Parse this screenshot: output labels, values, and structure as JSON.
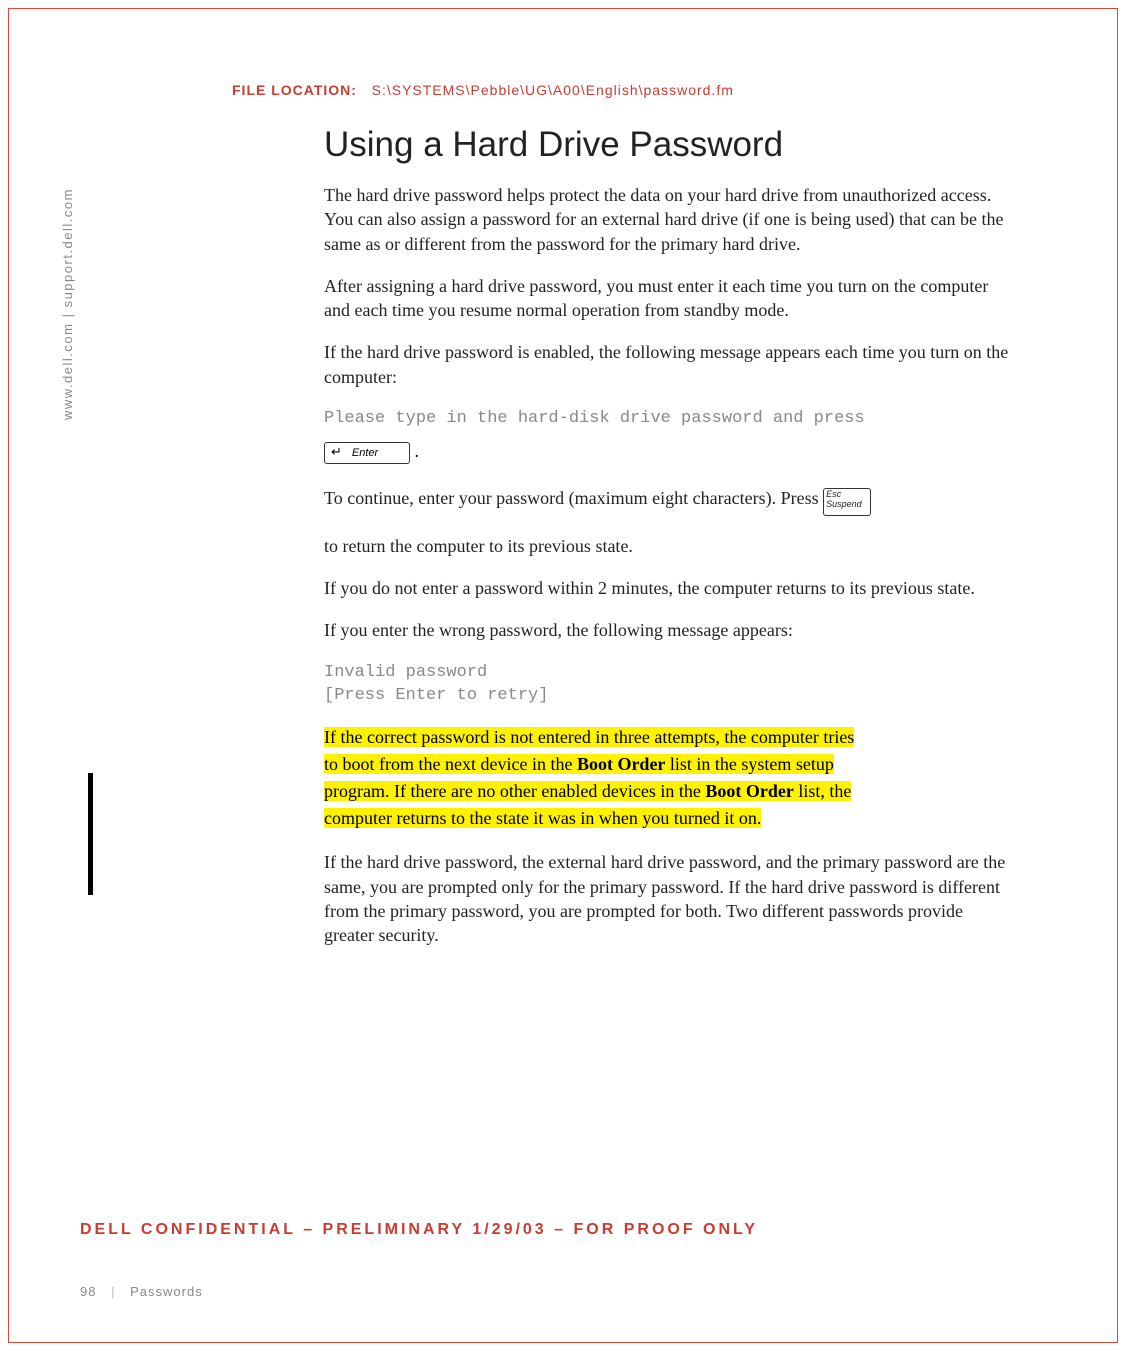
{
  "file_location": {
    "label": "FILE LOCATION:",
    "path": "S:\\SYSTEMS\\Pebble\\UG\\A00\\English\\password.fm"
  },
  "sidebar_url": "www.dell.com | support.dell.com",
  "heading": "Using a Hard Drive Password",
  "para1": "The hard drive password helps protect the data on your hard drive from unauthorized access. You can also assign a password for an external hard drive (if one is being used) that can be the same as or different from the password for the primary hard drive.",
  "para2": "After assigning a hard drive password, you must enter it each time you turn on the computer and each time you resume normal operation from standby mode.",
  "para3": "If the hard drive password is enabled, the following message appears each time you turn on the computer:",
  "code1": "Please type in the hard-disk drive password and press",
  "key_enter": "Enter",
  "period": ".",
  "para4_pre": "To continue, enter your password (maximum eight characters). Press ",
  "key_esc_top": "Esc",
  "key_esc_bottom": "Suspend",
  "para5": "to return the computer to its previous state.",
  "para6": "If you do not enter a password within 2 minutes, the computer returns to its previous state.",
  "para7": "If you enter the wrong password, the following message appears:",
  "code2": "Invalid password\n[Press Enter to retry]",
  "hl": {
    "t1": "If the correct password is not entered in three attempts, the computer tries",
    "t2": "to boot from the next device in the ",
    "b1": "Boot Order",
    "t3": " list in the system setup",
    "t4": "program. If there are no other enabled devices in the ",
    "b2": "Boot Order",
    "t5": " list, the",
    "t6": "computer returns to the state it was in when you turned it on."
  },
  "para8": "If the hard drive password, the external hard drive password, and the primary password are the same, you are prompted only for the primary password. If the hard drive password is different from the primary password, you are prompted for both. Two different passwords provide greater security.",
  "confidential": "DELL CONFIDENTIAL – PRELIMINARY 1/29/03 – FOR PROOF ONLY",
  "footer": {
    "page": "98",
    "section": "Passwords"
  }
}
